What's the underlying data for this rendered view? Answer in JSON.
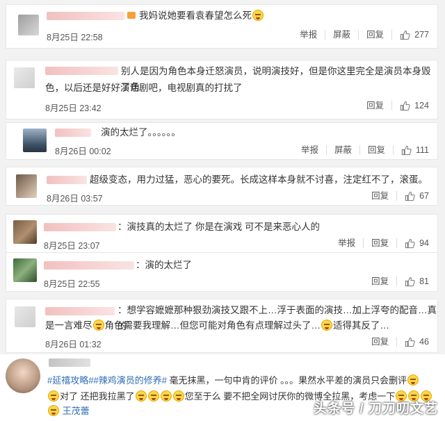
{
  "actions": {
    "report": "举报",
    "block": "屏蔽",
    "reply": "回复"
  },
  "icons": {
    "like": "thumbs-up-icon",
    "emoji": "laughing-emoji-icon"
  },
  "comments": [
    {
      "text": "我妈说她要看袁春望怎么死",
      "time": "8月25日 22:58",
      "likes": "277"
    },
    {
      "text_line1": "别人是因为角色本身迁怒演员，说明演技好，但是你这里完全是演员本身毁了角",
      "text_line2": "色，以后还是好好演话剧吧，电视剧真的打扰了",
      "time": "8月25日 23:42",
      "likes": "124"
    },
    {
      "text": "演的太烂了。。。。。。",
      "time": "8月26日 00:02",
      "likes": "111"
    },
    {
      "text": "超级变态，用力过猛，恶心的要死。长成这样本身就不讨喜，注定红不了，滚蛋。",
      "time": "8月26日 03:57",
      "likes": "67"
    },
    {
      "text": "：演技真的太烂了 你是在演戏 可不是来恶心人的",
      "time": "8月25日 23:07",
      "likes": "94"
    },
    {
      "text": "：演的太烂了",
      "time": "8月25日 22:55",
      "likes": "81"
    },
    {
      "text_line1": "：想学容嬷嬷那种狠劲演技又跟不上…浮于表面的演技…加上浮夸的配音…真的",
      "text_line2_a": "是一言难尽",
      "text_line2_b": "角色需要我理解…但您可能对角色有点理解过头了…",
      "text_line2_c": "适得其反了…",
      "time": "8月26日 01:32",
      "likes": "46"
    }
  ],
  "post": {
    "tag1": "#延禧攻略#",
    "tag2": "#辣鸡演员的修养#",
    "line1_rest": " 毫无抹黑，一句中肯的评价 。。。果然水平差的演员只会删评",
    "line2_a": "对了 还把我拉黑了",
    "line2_b": "您至于么 要不把全网讨厌你的微博全拉黑，考虑一下",
    "mention": "王茂蕾"
  },
  "watermark": "头条号 / 刀刀叨文艺"
}
